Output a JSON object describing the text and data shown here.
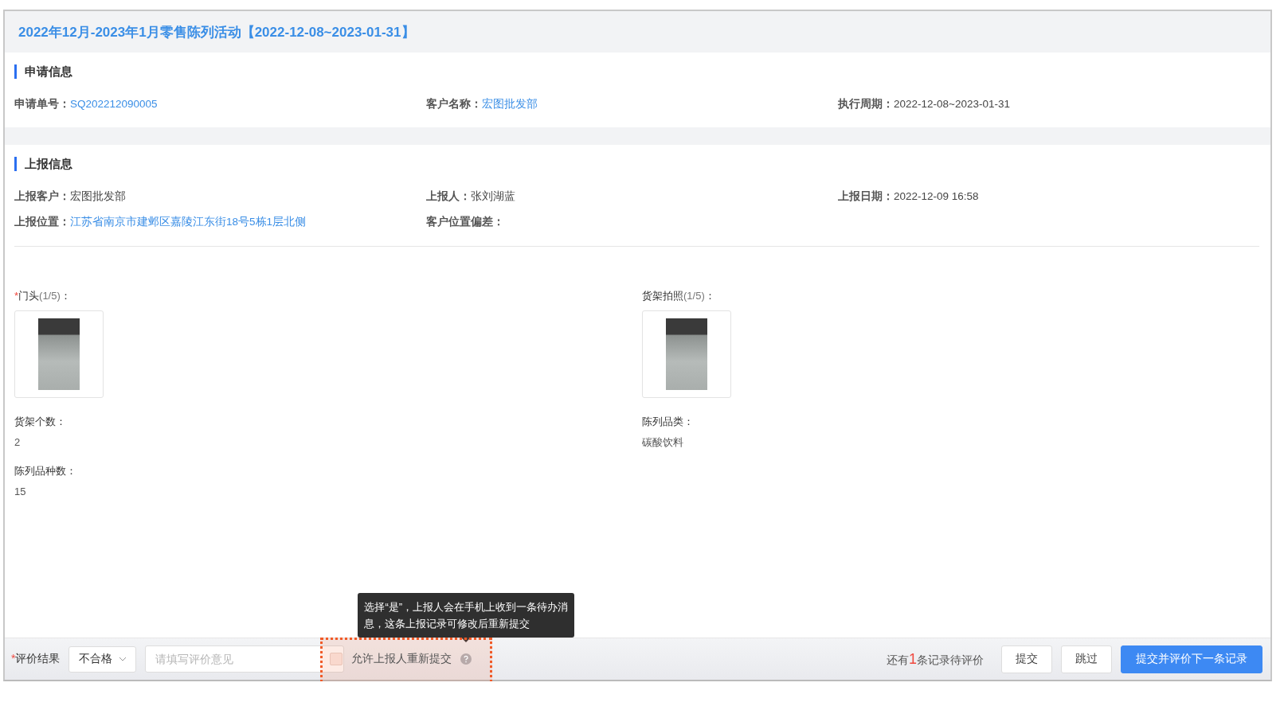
{
  "title": "2022年12月-2023年1月零售陈列活动【2022-12-08~2023-01-31】",
  "sections": [
    {
      "heading": "申请信息",
      "fields": [
        {
          "label": "申请单号：",
          "value": "SQ202212090005",
          "kind": "link"
        },
        {
          "label": "客户名称：",
          "value": "宏图批发部",
          "kind": "link"
        },
        {
          "label": "执行周期：",
          "value": "2022-12-08~2023-01-31",
          "kind": "plain"
        }
      ]
    },
    {
      "heading": "上报信息",
      "fields": [
        {
          "label": "上报客户：",
          "value": "宏图批发部",
          "kind": "plain"
        },
        {
          "label": "上报人：",
          "value": "张刘湖蓝",
          "kind": "plain"
        },
        {
          "label": "上报日期：",
          "value": "2022-12-09 16:58",
          "kind": "plain"
        },
        {
          "label": "上报位置：",
          "value": "江苏省南京市建邺区嘉陵江东街18号5栋1层北侧",
          "kind": "link"
        },
        {
          "label": "客户位置偏差：",
          "kind": "plain"
        }
      ]
    }
  ],
  "details": [
    [
      {
        "kind": "photos",
        "required_mark": "*",
        "label": "门头",
        "count": "(1/5)",
        "colon": "："
      },
      {
        "kind": "text",
        "label": "货架个数：",
        "value": "2"
      },
      {
        "kind": "text",
        "label": "陈列品种数：",
        "value": "15"
      }
    ],
    [
      {
        "kind": "photos",
        "label": "货架拍照",
        "count": "(1/5)",
        "colon": "："
      },
      {
        "kind": "text",
        "label": "陈列品类：",
        "value": "碳酸饮料"
      }
    ]
  ],
  "footer": {
    "required_mark": "*",
    "label": "评价结果",
    "select": "不合格",
    "comment_placeholder": "请填写评价意见",
    "allow_resubmit": {
      "checked": false,
      "label": "允许上报人重新提交"
    },
    "tooltip": "选择“是”，上报人会在手机上收到一条待办消息，这条上报记录可修改后重新提交",
    "pending": {
      "before": "还有",
      "count": "1",
      "after": "条记录待评价"
    },
    "buttons": [
      {
        "label": "提交",
        "kind": "default"
      },
      {
        "label": "跳过",
        "kind": "default"
      },
      {
        "label": "提交并评价下一条记录",
        "kind": "primary"
      }
    ]
  }
}
